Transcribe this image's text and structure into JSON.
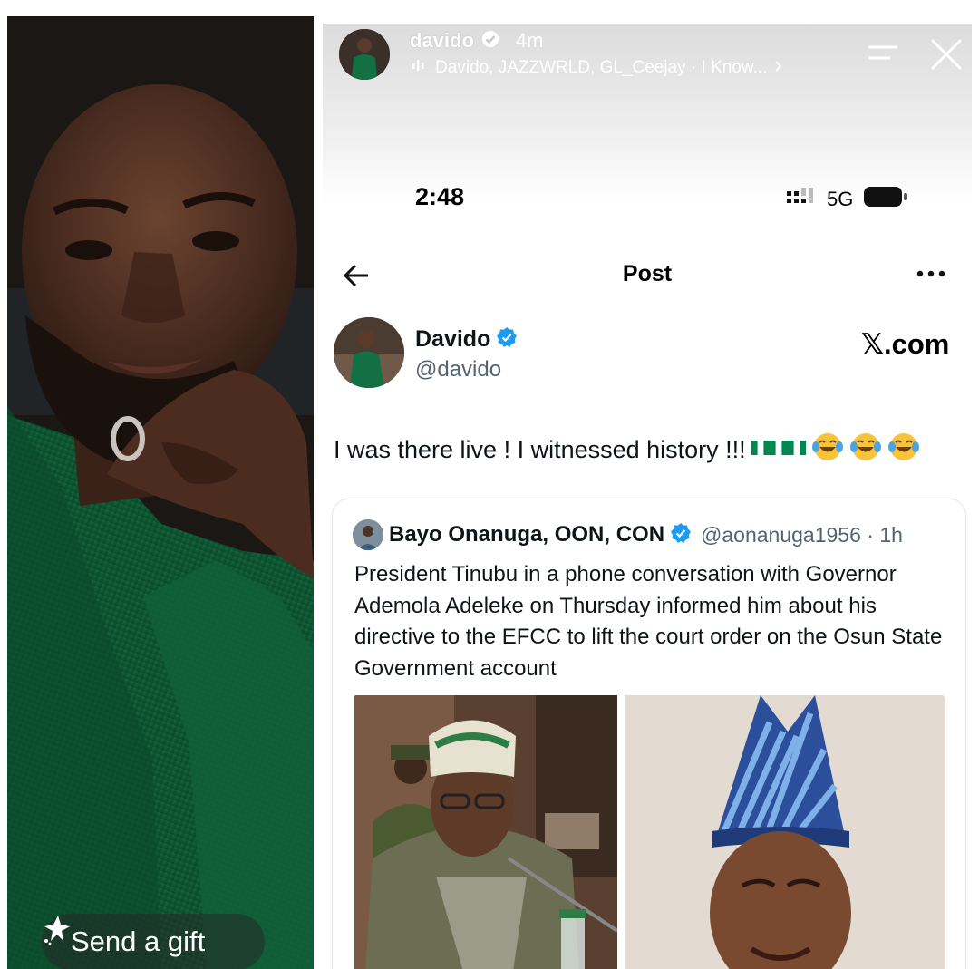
{
  "story": {
    "username": "davido",
    "time_ago": "4m",
    "music": "Davido, JAZZWRLD, GL_Ceejay · I Know...",
    "gift_label": "Send a gift"
  },
  "status_bar": {
    "time": "2:48",
    "network": "5G"
  },
  "x_header": {
    "title": "Post"
  },
  "post": {
    "author_name": "Davido",
    "author_handle": "@davido",
    "brand": "𝕏.com",
    "text": "I was there live ! I witnessed history !!! "
  },
  "quote": {
    "author_name": "Bayo Onanuga, OON, CON",
    "handle_time": "@aonanuga1956 · 1h",
    "body": "President Tinubu in a phone conversation with Governor Ademola Adeleke on Thursday informed him about his directive to the EFCC to lift the court order on the Osun State Government account"
  },
  "colors": {
    "verified_blue": "#1d9bf0",
    "jacket_green": "#0f5a34",
    "nigeria_green": "#008751"
  }
}
